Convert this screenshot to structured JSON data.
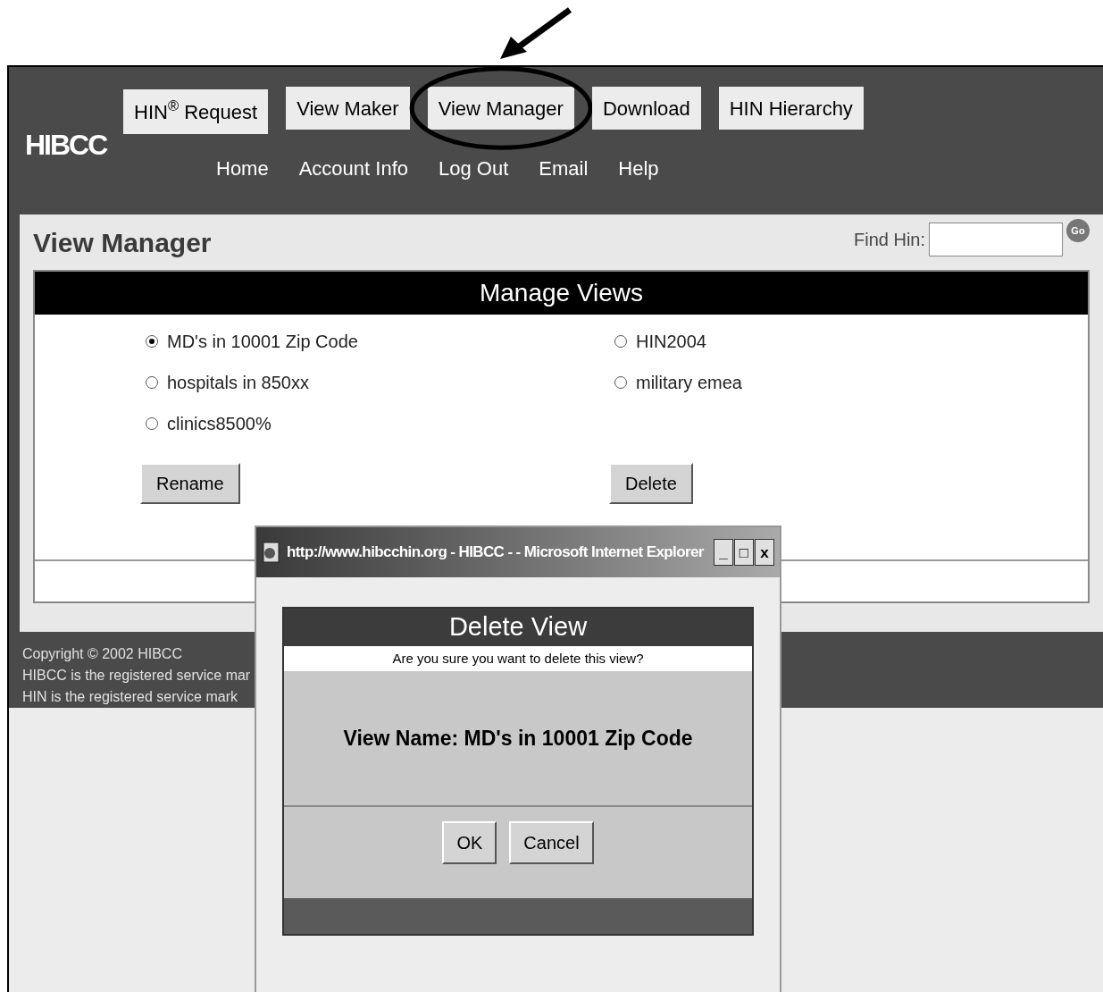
{
  "annotation": {
    "arrow": true
  },
  "logo": "HIBCC",
  "nav_buttons": [
    {
      "label": "HIN$^{®}$ Request",
      "circled": false
    },
    {
      "label": "View Maker",
      "circled": false
    },
    {
      "label": "View Manager",
      "circled": true
    },
    {
      "label": "Download",
      "circled": false
    },
    {
      "label": "HIN Hierarchy",
      "circled": false
    }
  ],
  "nav_links": [
    "Home",
    "Account Info",
    "Log Out",
    "Email",
    "Help"
  ],
  "page_title": "View Manager",
  "find": {
    "label": "Find Hin:",
    "go": "Go"
  },
  "panel": {
    "title": "Manage Views",
    "views": [
      [
        {
          "label": "MD's in 10001 Zip Code",
          "selected": true
        },
        {
          "label": "hospitals in 850xx",
          "selected": false
        },
        {
          "label": "clinics8500%",
          "selected": false
        }
      ],
      [
        {
          "label": "HIN2004",
          "selected": false
        },
        {
          "label": "military emea",
          "selected": false
        }
      ]
    ],
    "buttons": [
      "Rename",
      "Delete"
    ]
  },
  "footer": [
    "Copyright © 2002 HIBCC",
    "HIBCC is the registered service mar",
    "HIN is the registered service mark"
  ],
  "popup": {
    "title": "http://www.hibcchin.org - HIBCC - - Microsoft Internet Explorer",
    "controls": [
      "_",
      "□",
      "x"
    ],
    "heading": "Delete View",
    "question": "Are you sure you want to delete this view?",
    "view_name": "View Name: MD's in 10001 Zip Code",
    "buttons": [
      "OK",
      "Cancel"
    ]
  }
}
